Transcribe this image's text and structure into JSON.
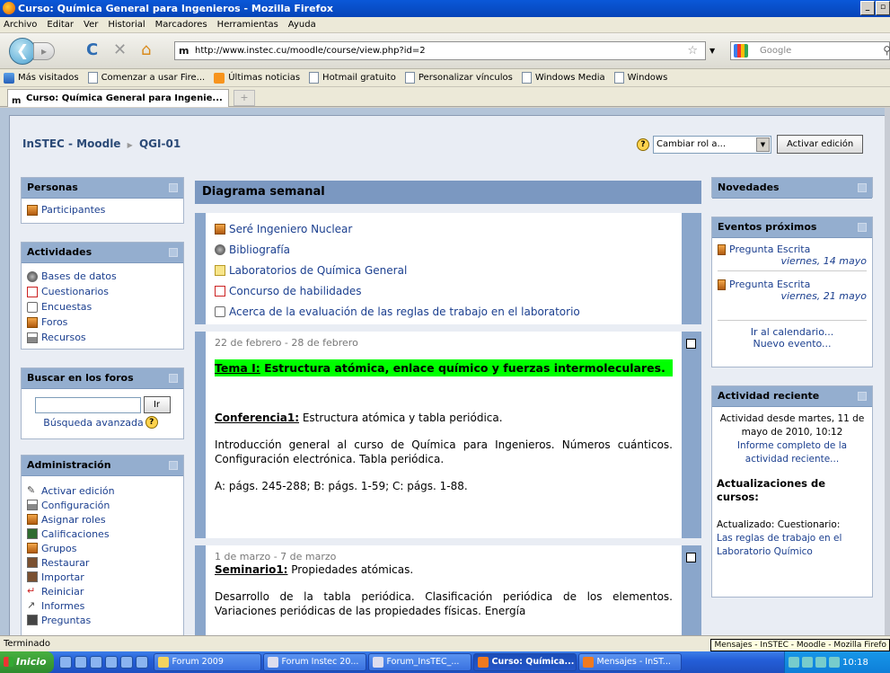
{
  "window": {
    "title": "Curso: Química General para Ingenieros - Mozilla Firefox",
    "controls": [
      "_",
      "▫",
      "×"
    ]
  },
  "menu": [
    "Archivo",
    "Editar",
    "Ver",
    "Historial",
    "Marcadores",
    "Herramientas",
    "Ayuda"
  ],
  "nav": {
    "url": "http://www.instec.cu/moodle/course/view.php?id=2",
    "search_placeholder": "Google"
  },
  "bookmarks": [
    "Más visitados",
    "Comenzar a usar Fire...",
    "Últimas noticias",
    "Hotmail gratuito",
    "Personalizar vínculos",
    "Windows Media",
    "Windows"
  ],
  "tab": {
    "label": "Curso: Química General para Ingenie..."
  },
  "moodle": {
    "site": "InSTEC - Moodle",
    "sep": "▶",
    "course": "QGI-01",
    "role_select": "Cambiar rol a...",
    "edit_button": "Activar edición"
  },
  "left": {
    "personas": {
      "title": "Personas",
      "items": [
        "Participantes"
      ]
    },
    "actividades": {
      "title": "Actividades",
      "items": [
        "Bases de datos",
        "Cuestionarios",
        "Encuestas",
        "Foros",
        "Recursos"
      ]
    },
    "buscar": {
      "title": "Buscar en los foros",
      "button": "Ir",
      "advanced": "Búsqueda avanzada"
    },
    "admin": {
      "title": "Administración",
      "items": [
        "Activar edición",
        "Configuración",
        "Asignar roles",
        "Calificaciones",
        "Grupos",
        "Restaurar",
        "Importar",
        "Reiniciar",
        "Informes",
        "Preguntas"
      ]
    }
  },
  "center": {
    "title": "Diagrama semanal",
    "intro_links": [
      "Seré Ingeniero Nuclear",
      "Bibliografía",
      "Laboratorios de Química General",
      "Concurso de habilidades",
      "Acerca de la evaluación de las reglas de trabajo en el laboratorio"
    ],
    "week1": {
      "date": "22 de febrero - 28 de febrero",
      "tema_label": "Tema I:",
      "tema_text": " Estructura atómica, enlace químico y fuerzas intermoleculares.",
      "conf_label": "Conferencia1:",
      "conf_text": " Estructura atómica y tabla periódica.",
      "desc": "Introducción general al curso de Química para Ingenieros. Números cuánticos. Configuración electrónica. Tabla periódica.",
      "refs": "A: págs. 245-288; B: págs. 1-59; C: págs. 1-88."
    },
    "week2": {
      "date": "1 de marzo - 7 de marzo",
      "sem_label": "Seminario1:",
      "sem_text": " Propiedades atómicas.",
      "desc": "Desarrollo de la tabla periódica. Clasificación periódica de los elementos. Variaciones periódicas de las propiedades físicas. Energía"
    }
  },
  "right": {
    "novedades": {
      "title": "Novedades"
    },
    "eventos": {
      "title": "Eventos próximos",
      "items": [
        {
          "name": "Pregunta Escrita",
          "date": "viernes, 14 mayo"
        },
        {
          "name": "Pregunta Escrita",
          "date": "viernes, 21 mayo"
        }
      ],
      "calendar": "Ir al calendario...",
      "new_event": "Nuevo evento..."
    },
    "actividad": {
      "title": "Actividad reciente",
      "since": "Actividad desde martes, 11 de mayo de 2010, 10:12",
      "full_report": "Informe completo de la actividad reciente...",
      "updates_title": "Actualizaciones de cursos:",
      "updated": "Actualizado: Cuestionario:",
      "updated_link": "Las reglas de trabajo en el Laboratorio Químico"
    }
  },
  "status": {
    "text": "Terminado",
    "tooltip": "Mensajes - InSTEC - Moodle - Mozilla Firefo"
  },
  "taskbar": {
    "start": "Inicio",
    "items": [
      "Forum 2009",
      "Forum Instec 20...",
      "Forum_InsTEC_...",
      "Curso: Química...",
      "Mensajes - InST..."
    ],
    "clock": "10:18"
  }
}
